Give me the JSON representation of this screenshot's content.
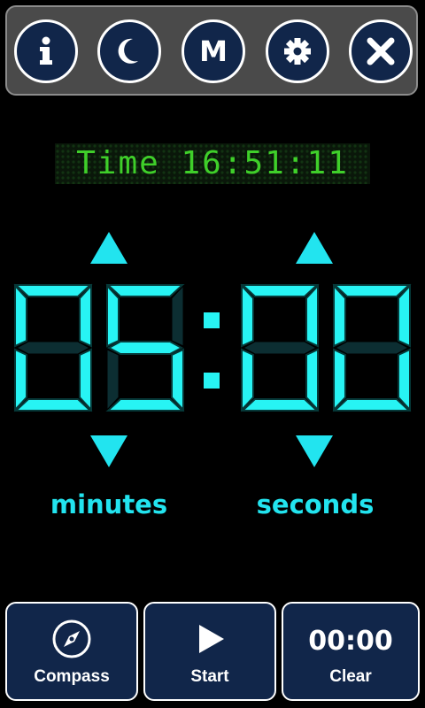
{
  "toolbar": {
    "buttons": [
      {
        "name": "info-icon"
      },
      {
        "name": "moon-icon"
      },
      {
        "name": "m-icon",
        "letter": "M"
      },
      {
        "name": "gear-icon"
      },
      {
        "name": "close-icon"
      }
    ]
  },
  "clock": {
    "text": "Time 16:51:11",
    "color": "#3fcf2a"
  },
  "timer": {
    "minutes": "05",
    "seconds": "00",
    "separator": ":",
    "color": "#27f4f4"
  },
  "labels": {
    "minutes": "minutes",
    "seconds": "seconds"
  },
  "bottom": {
    "compass": {
      "label": "Compass",
      "icon": "compass-icon"
    },
    "start": {
      "label": "Start",
      "icon": "play-icon"
    },
    "clear": {
      "label": "Clear",
      "time": "00:00"
    }
  }
}
